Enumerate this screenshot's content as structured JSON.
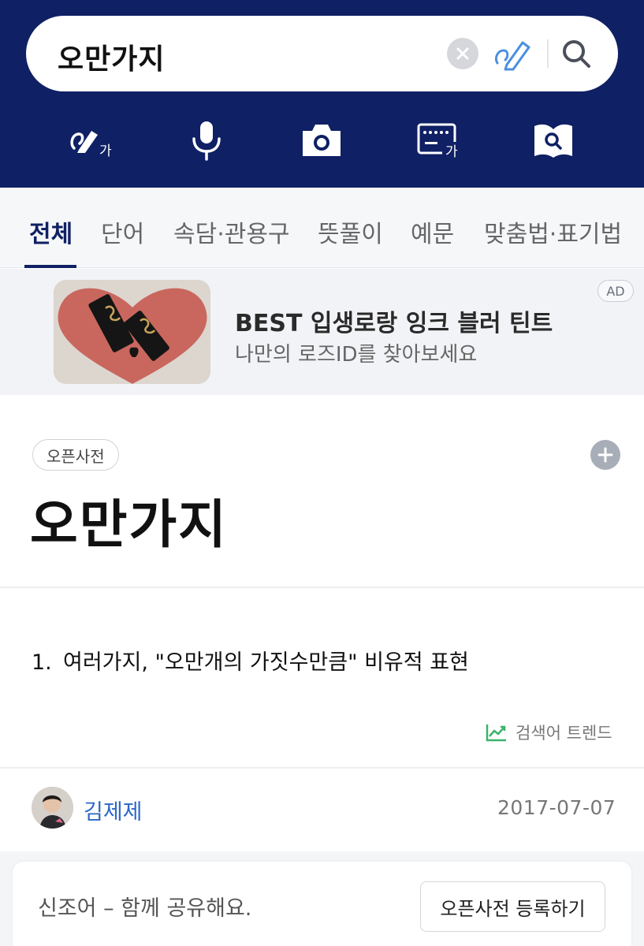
{
  "search": {
    "query": "오만가지"
  },
  "tools": {
    "handwriting_label": "가",
    "keyboard_label": "가"
  },
  "tabs": [
    {
      "label": "전체",
      "active": true
    },
    {
      "label": "단어"
    },
    {
      "label": "속담·관용구"
    },
    {
      "label": "뜻풀이"
    },
    {
      "label": "예문"
    },
    {
      "label": "맞춤법·표기법"
    }
  ],
  "ad": {
    "title": "BEST 입생로랑 잉크 블러 틴트",
    "subtitle": "나만의 로즈ID를 찾아보세요",
    "badge": "AD"
  },
  "entry": {
    "source_chip": "오픈사전",
    "title": "오만가지",
    "definition_number": "1.",
    "definition_text": "여러가지, \"오만개의 가짓수만큼\" 비유적 표현",
    "trend_label": "검색어 트렌드",
    "author": "김제제",
    "date": "2017-07-07"
  },
  "share": {
    "text": "신조어 – 함께 공유해요.",
    "button_label": "오픈사전 등록하기"
  },
  "colors": {
    "header_bg": "#0f2064",
    "accent_blue": "#2b67c7",
    "trend_green": "#3bb36a"
  }
}
